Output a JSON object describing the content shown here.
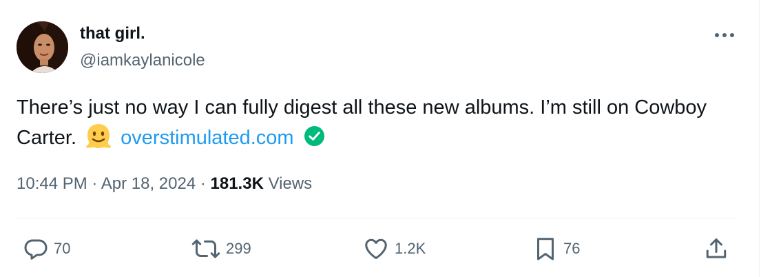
{
  "author": {
    "display_name": "that girl.",
    "handle": "@iamkaylanicole",
    "avatar_icon": "profile-photo"
  },
  "tweet": {
    "text_part1": "There’s just no way I can fully digest all these new albums. I’m still on Cowboy Carter.",
    "emoji_icon": "melting-face-icon",
    "link_text": "overstimulated.com",
    "verified_icon": "verified-check-icon"
  },
  "meta": {
    "time": "10:44 PM",
    "separator": " · ",
    "date": "Apr 18, 2024",
    "views_count": "181.3K",
    "views_label": " Views"
  },
  "actions": {
    "replies": "70",
    "reposts": "299",
    "likes": "1.2K",
    "bookmarks": "76"
  },
  "colors": {
    "link": "#1d9bf0",
    "secondary_text": "#536471",
    "verified": "#00ba7c"
  }
}
